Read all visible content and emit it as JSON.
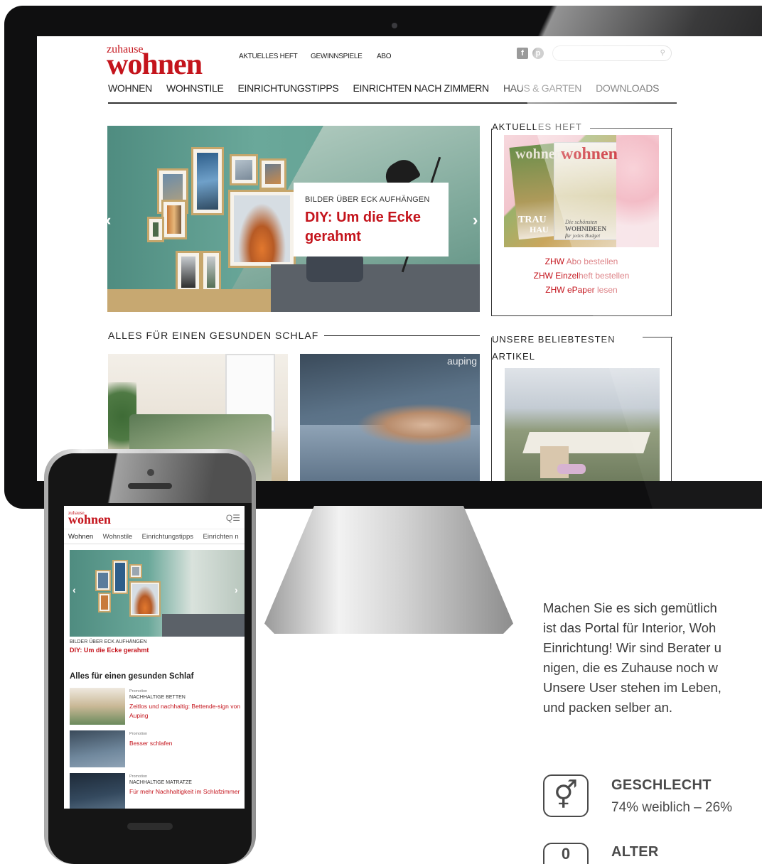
{
  "desktop": {
    "logo": {
      "small": "zuhause",
      "big": "wohnen"
    },
    "top_links": [
      "AKTUELLES HEFT",
      "GEWINNSPIELE",
      "ABO"
    ],
    "social": {
      "facebook": "f",
      "pinterest": "p"
    },
    "search": {
      "placeholder": "",
      "icon": "search-icon"
    },
    "nav": [
      "WOHNEN",
      "WOHNSTILE",
      "EINRICHTUNGSTIPPS",
      "EINRICHTEN NACH ZIMMERN",
      "HAUS & GARTEN",
      "DOWNLOADS"
    ],
    "hero": {
      "kicker": "BILDER ÜBER ECK AUFHÄNGEN",
      "headline_line1": "DIY: Um die Ecke",
      "headline_line2": "gerahmt",
      "prev": "‹",
      "next": "›"
    },
    "section_title": "ALLES FÜR EINEN GESUNDEN SCHLAF",
    "card2_badge": "auping",
    "sidebar": {
      "heft_title": "AKTUELLES HEFT",
      "cover_text": [
        "wohnen",
        "wohnen",
        "TRAU",
        "HAU",
        "Die schönsten",
        "WOHNIDEEN",
        "für jedes Budget"
      ],
      "links": [
        {
          "a": "ZHW",
          "b": " Abo bestellen"
        },
        {
          "a": "ZHW Einzel",
          "b": "heft bestellen"
        },
        {
          "a": "ZHW ePaper",
          "b": " lesen"
        }
      ],
      "popular_title_line1": "UNSERE BELIEBTESTEN",
      "popular_title_line2": "ARTIKEL"
    }
  },
  "mobile": {
    "logo": {
      "small": "zuhause",
      "big": "wohnen"
    },
    "menu_icon": "Q☰",
    "nav": [
      "Wohnen",
      "Wohnstile",
      "Einrichtungstipps",
      "Einrichten n"
    ],
    "hero": {
      "kicker": "BILDER ÜBER ECK AUFHÄNGEN",
      "headline": "DIY: Um die Ecke gerahmt",
      "prev": "‹",
      "next": "›"
    },
    "section_title": "Alles für einen gesunden Schlaf",
    "items": [
      {
        "promo": "Promotion",
        "kicker": "NACHHALTIGE BETTEN",
        "title": "Zeitlos und nachhaltig: Bettende-sign von Auping"
      },
      {
        "promo": "Promotion",
        "kicker": "",
        "title": "Besser schlafen"
      },
      {
        "promo": "Promotion",
        "kicker": "NACHHALTIGE MATRATZE",
        "title": "Für mehr Nachhaltigkeit im Schlafzimmer"
      }
    ]
  },
  "blurb_lines": [
    "Machen Sie es sich gemütlich",
    "ist das Portal für Interior, Woh",
    "Einrichtung! Wir sind Berater u",
    "nigen, die es Zuhause noch w",
    "Unsere User stehen im Leben,",
    "und packen selber an."
  ],
  "stats": [
    {
      "icon": "gender-icon",
      "symbol": "⚥",
      "label": "GESCHLECHT",
      "value": "74% weiblich – 26%"
    },
    {
      "icon": "age-icon",
      "symbol": "0",
      "label": "ALTER",
      "value": ""
    }
  ]
}
